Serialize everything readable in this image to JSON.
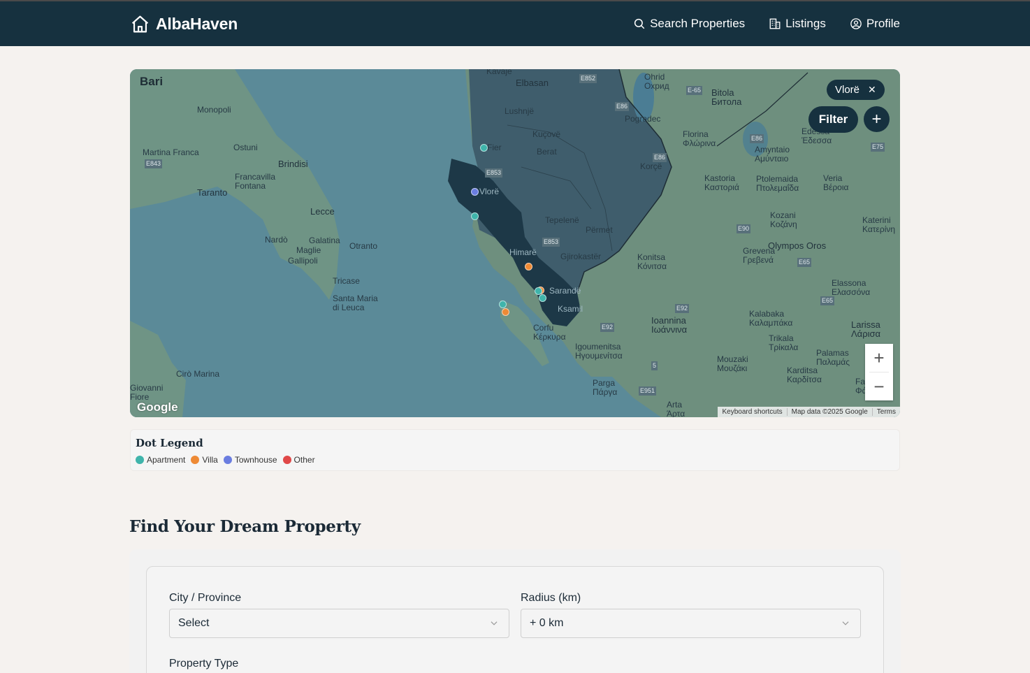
{
  "header": {
    "brand": "AlbaHaven",
    "nav": [
      {
        "label": "Search Properties",
        "icon": "search-icon"
      },
      {
        "label": "Listings",
        "icon": "building-icon"
      },
      {
        "label": "Profile",
        "icon": "user-circle-icon"
      }
    ]
  },
  "map": {
    "region_chip": "Vlorë",
    "filter_label": "Filter",
    "google_logo": "Google",
    "attribution": [
      "Keyboard shortcuts",
      "Map data ©2025 Google",
      "Terms"
    ],
    "labels": [
      "Bari",
      "Monopoli",
      "Ostuni",
      "Brindisi",
      "Martina Franca",
      "Francavilla Fontana",
      "Taranto",
      "Lecce",
      "Nardò",
      "Galatina",
      "Otranto",
      "Maglie",
      "Gallipoli",
      "Tricase",
      "Santa Maria di Leuca",
      "Cirò Marina",
      "Giovanni Fiore",
      "Kavaje",
      "Elbasan",
      "Lushnjë",
      "Kuçovë",
      "Fier",
      "Berat",
      "Vlorë",
      "Tepelenë",
      "Përmet",
      "Himarë",
      "Gjirokastër",
      "Sarandë",
      "Ksamil",
      "Corfu Κέρκυρα",
      "Igoumenitsa Ηγουμενίτσα",
      "Parga Πάργα",
      "Ohrid Охрид",
      "Bitola Битола",
      "Pogradec",
      "Korçë",
      "Florina Φλώρινα",
      "Edessa Έδεσσα",
      "Amyntaio Αμύνταιο",
      "Kastoria Καστοριά",
      "Ptolemaida Πτολεμαΐδα",
      "Veria Βέροια",
      "Kozani Κοζάνη",
      "Katerini Κατερίνη",
      "Olympos Oros",
      "Konitsa Κόνιτσα",
      "Grevena Γρεβενά",
      "Elassona Ελασσόνα",
      "Ioannina Ιωάννινα",
      "Kalabaka Καλαμπάκα",
      "Trikala Τρίκαλα",
      "Larissa Λάρισα",
      "Mouzaki Μουζάκι",
      "Palamas Παλαμάς",
      "Karditsa Καρδίτσα",
      "Arta Άρτα",
      "Farsala Φάρσαλα"
    ],
    "road_labels": [
      "E852",
      "E86",
      "E-65",
      "E86",
      "E86",
      "E75",
      "E853",
      "E853",
      "E90",
      "E65",
      "E65",
      "E92",
      "E92",
      "E951",
      "E843",
      "5"
    ],
    "dots": [
      {
        "type": "Apartment",
        "color": "#3fb4ab"
      },
      {
        "type": "Townhouse",
        "color": "#6a7de0"
      },
      {
        "type": "Apartment",
        "color": "#3fb4ab"
      },
      {
        "type": "Villa",
        "color": "#ee8a35"
      },
      {
        "type": "Villa",
        "color": "#ee8a35"
      },
      {
        "type": "Apartment",
        "color": "#3fb4ab"
      },
      {
        "type": "Apartment",
        "color": "#3fb4ab"
      },
      {
        "type": "Apartment",
        "color": "#3fb4ab"
      },
      {
        "type": "Villa",
        "color": "#ee8a35"
      }
    ]
  },
  "legend": {
    "title": "Dot Legend",
    "items": [
      {
        "label": "Apartment",
        "color": "#3fb4ab"
      },
      {
        "label": "Villa",
        "color": "#ee8a35"
      },
      {
        "label": "Townhouse",
        "color": "#6a7de0"
      },
      {
        "label": "Other",
        "color": "#e04848"
      }
    ]
  },
  "search": {
    "title": "Find Your Dream Property",
    "city_label": "City / Province",
    "city_value": "Select",
    "radius_label": "Radius (km)",
    "radius_value": "+ 0 km",
    "type_label": "Property Type"
  }
}
